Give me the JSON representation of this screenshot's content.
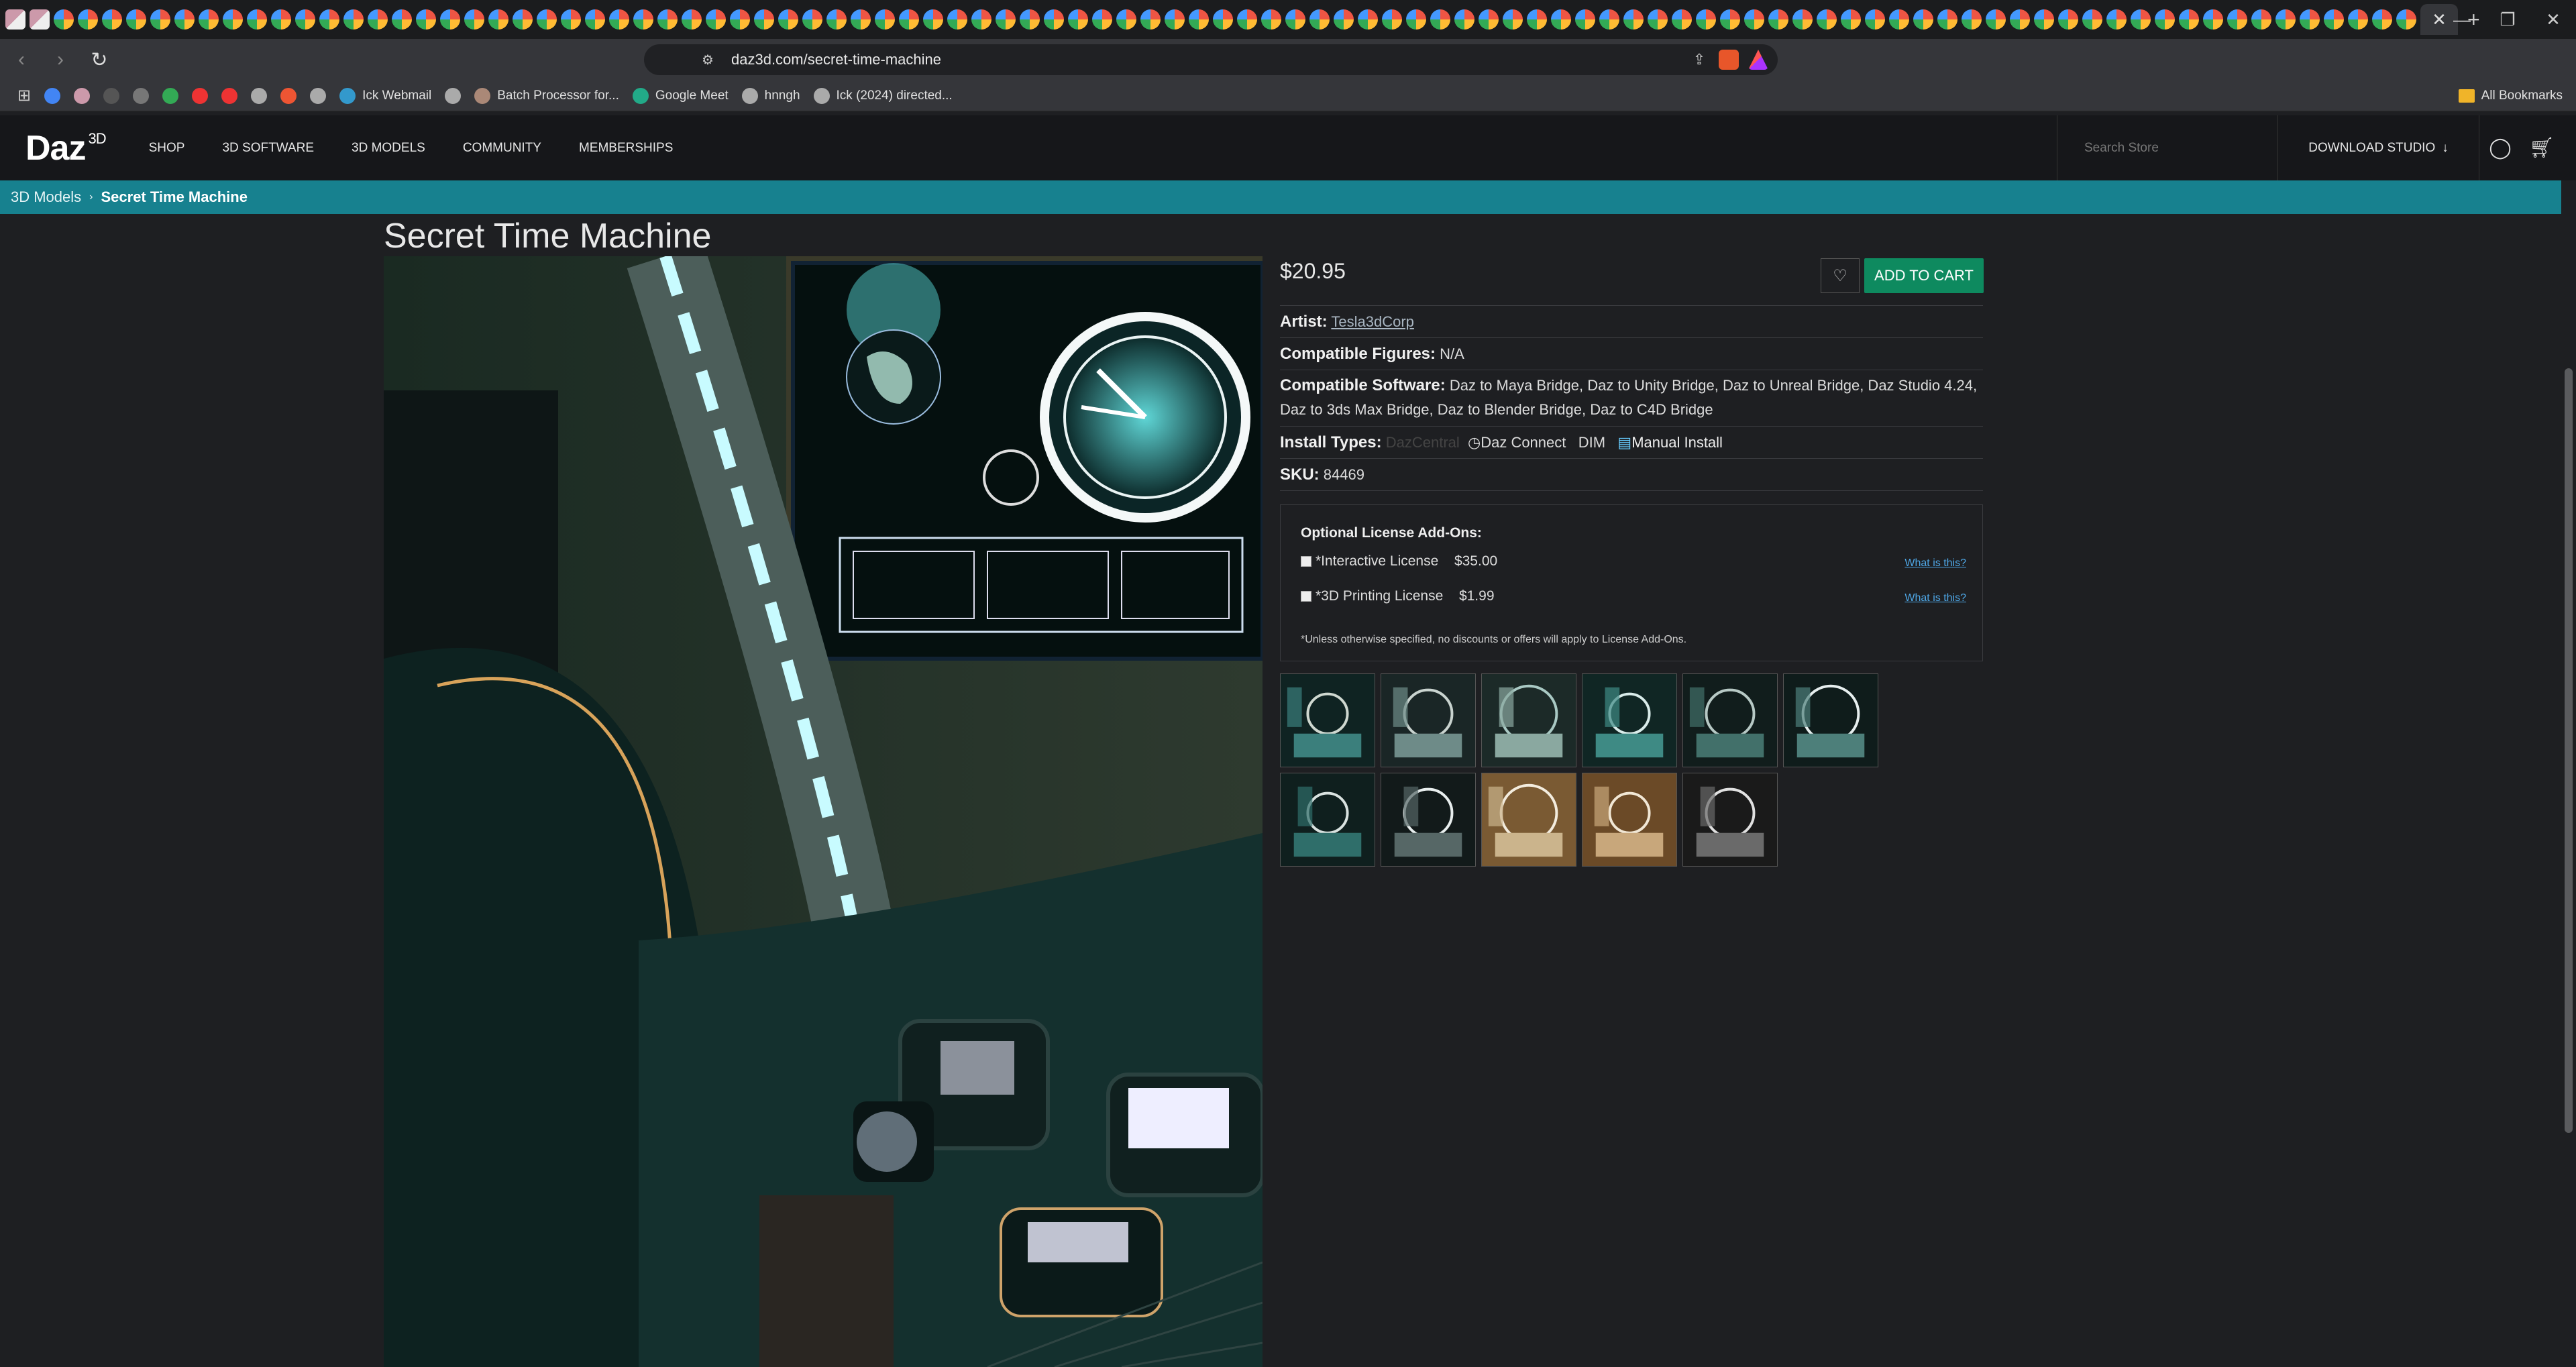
{
  "browser": {
    "active_tab_close": "✕",
    "new_tab": "+",
    "url": "daz3d.com/secret-time-machine",
    "bookmarks": [
      {
        "label": ""
      },
      {
        "label": ""
      },
      {
        "label": ""
      },
      {
        "label": ""
      },
      {
        "label": ""
      },
      {
        "label": ""
      },
      {
        "label": ""
      },
      {
        "label": ""
      },
      {
        "label": ""
      },
      {
        "label": ""
      },
      {
        "label": "Ick Webmail"
      },
      {
        "label": ""
      },
      {
        "label": "Batch Processor for..."
      },
      {
        "label": "Google Meet"
      },
      {
        "label": "hnngh"
      },
      {
        "label": "Ick (2024) directed..."
      }
    ],
    "all_bookmarks": "All Bookmarks"
  },
  "site": {
    "logo": "Daz",
    "logo_sup": "3D",
    "nav": [
      "SHOP",
      "3D SOFTWARE",
      "3D MODELS",
      "COMMUNITY",
      "MEMBERSHIPS"
    ],
    "search_placeholder": "Search Store",
    "download_studio": "DOWNLOAD STUDIO",
    "breadcrumb": {
      "parent": "3D Models",
      "current": "Secret Time Machine"
    }
  },
  "product": {
    "title": "Secret Time Machine",
    "price": "$20.95",
    "add_to_cart": "ADD TO CART",
    "artist_label": "Artist:",
    "artist": "Tesla3dCorp",
    "figures_label": "Compatible Figures:",
    "figures": "N/A",
    "software_label": "Compatible Software:",
    "software_line1": "Daz to Maya Bridge, Daz to Unity Bridge, Daz to Unreal Bridge, Daz Studio 4.24,",
    "software_line2": "Daz to 3ds Max Bridge, Daz to Blender Bridge, Daz to C4D Bridge",
    "install_label": "Install Types:",
    "install_dazcentral": "DazCentral",
    "install_dazconnect": "Daz Connect",
    "install_dim": "DIM",
    "install_manual": "Manual Install",
    "sku_label": "SKU:",
    "sku": "84469"
  },
  "addons": {
    "header": "Optional License Add-Ons:",
    "items": [
      {
        "name": "*Interactive License",
        "price": "$35.00",
        "link": "What is this?"
      },
      {
        "name": "*3D Printing License",
        "price": "$1.99",
        "link": "What is this?"
      }
    ],
    "note": "*Unless otherwise specified, no discounts or offers will apply to License Add-Ons."
  },
  "colors": {
    "accent_teal": "#17818f",
    "cart_green": "#0e8a5f"
  }
}
